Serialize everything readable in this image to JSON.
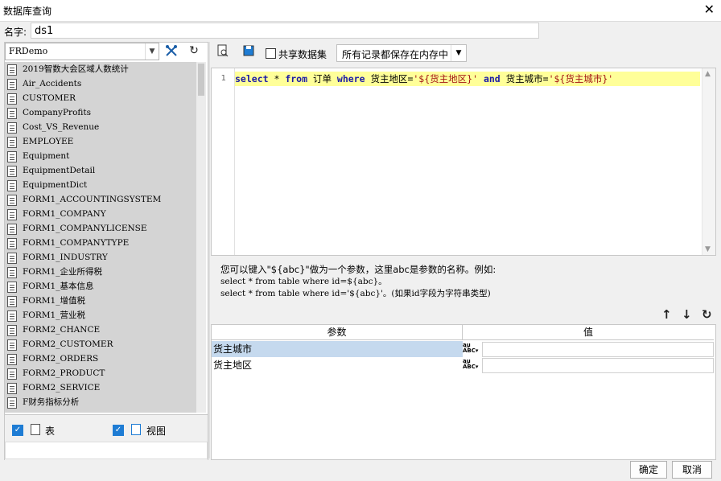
{
  "window": {
    "title": "数据库查询",
    "close": "✕"
  },
  "name_row": {
    "label": "名字:",
    "value": "ds1"
  },
  "left": {
    "connection": "FRDemo",
    "tables": [
      "2019智数大会区域人数统计",
      "Air_Accidents",
      "CUSTOMER",
      "CompanyProfits",
      "Cost_VS_Revenue",
      "EMPLOYEE",
      "Equipment",
      "EquipmentDetail",
      "EquipmentDict",
      "FORM1_ACCOUNTINGSYSTEM",
      "FORM1_COMPANY",
      "FORM1_COMPANYLICENSE",
      "FORM1_COMPANYTYPE",
      "FORM1_INDUSTRY",
      "FORM1_企业所得税",
      "FORM1_基本信息",
      "FORM1_增值税",
      "FORM1_营业税",
      "FORM2_CHANCE",
      "FORM2_CUSTOMER",
      "FORM2_ORDERS",
      "FORM2_PRODUCT",
      "FORM2_SERVICE",
      "F财务指标分析"
    ],
    "show_tables_label": "表",
    "show_views_label": "视图"
  },
  "right": {
    "share_label": "共享数据集",
    "mode": "所有记录都保存在内存中",
    "line_number": "1",
    "sql": {
      "k_select": "select",
      "star": " * ",
      "k_from": "from",
      "t1": " 订单 ",
      "k_where": "where",
      "t2": " 货主地区=",
      "s1": "'${货主地区}'",
      "t3": " ",
      "k_and": "and",
      "t4": " 货主城市=",
      "s2": "'${货主城市}'"
    },
    "hint": {
      "line1": "您可以键入\"${abc}\"做为一个参数，这里abc是参数的名称。例如:",
      "line2": "select * from table where id=${abc}。",
      "line3": "select * from table where id='${abc}'。(如果id字段为字符串类型)"
    },
    "params": {
      "col_param": "参数",
      "col_value": "值",
      "rows": [
        {
          "name": "货主城市",
          "value": ""
        },
        {
          "name": "货主地区",
          "value": ""
        }
      ]
    }
  },
  "buttons": {
    "ok": "确定",
    "cancel": "取消"
  }
}
